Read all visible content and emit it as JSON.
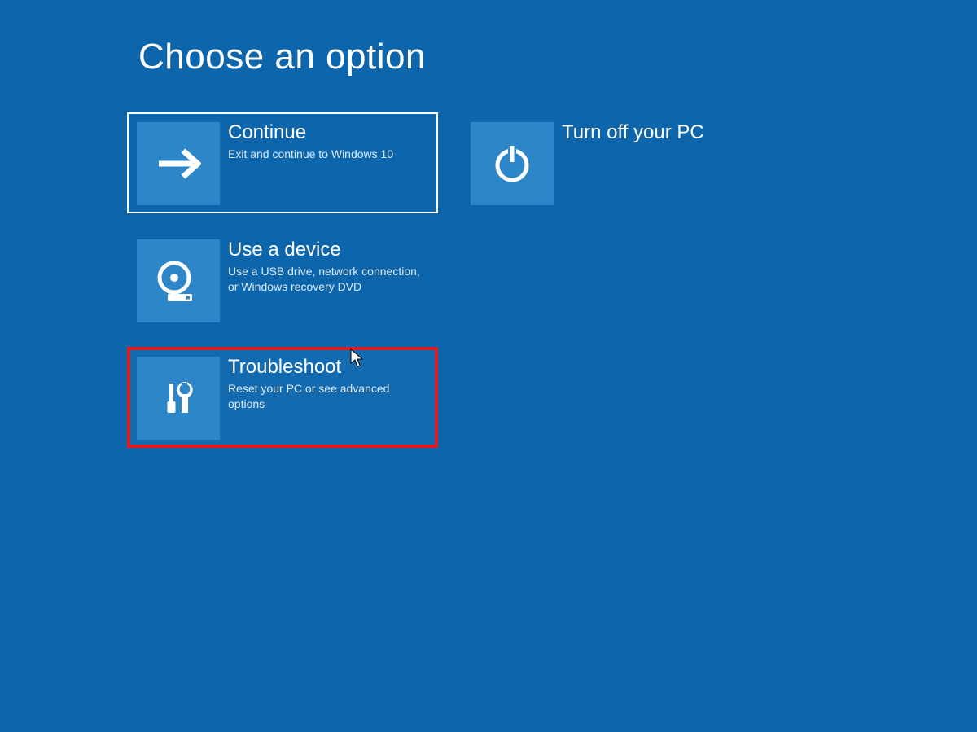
{
  "header": {
    "title": "Choose an option"
  },
  "options": {
    "continue": {
      "title": "Continue",
      "desc": "Exit and continue to Windows 10"
    },
    "turnoff": {
      "title": "Turn off your PC",
      "desc": ""
    },
    "usedevice": {
      "title": "Use a device",
      "desc": "Use a USB drive, network connection, or Windows recovery DVD"
    },
    "troubleshoot": {
      "title": "Troubleshoot",
      "desc": "Reset your PC or see advanced options"
    }
  },
  "colors": {
    "background": "#0d66ac",
    "tile_icon_bg": "#2c86c7",
    "highlight_border": "#e61a1a",
    "selected_border": "#ffffff"
  }
}
